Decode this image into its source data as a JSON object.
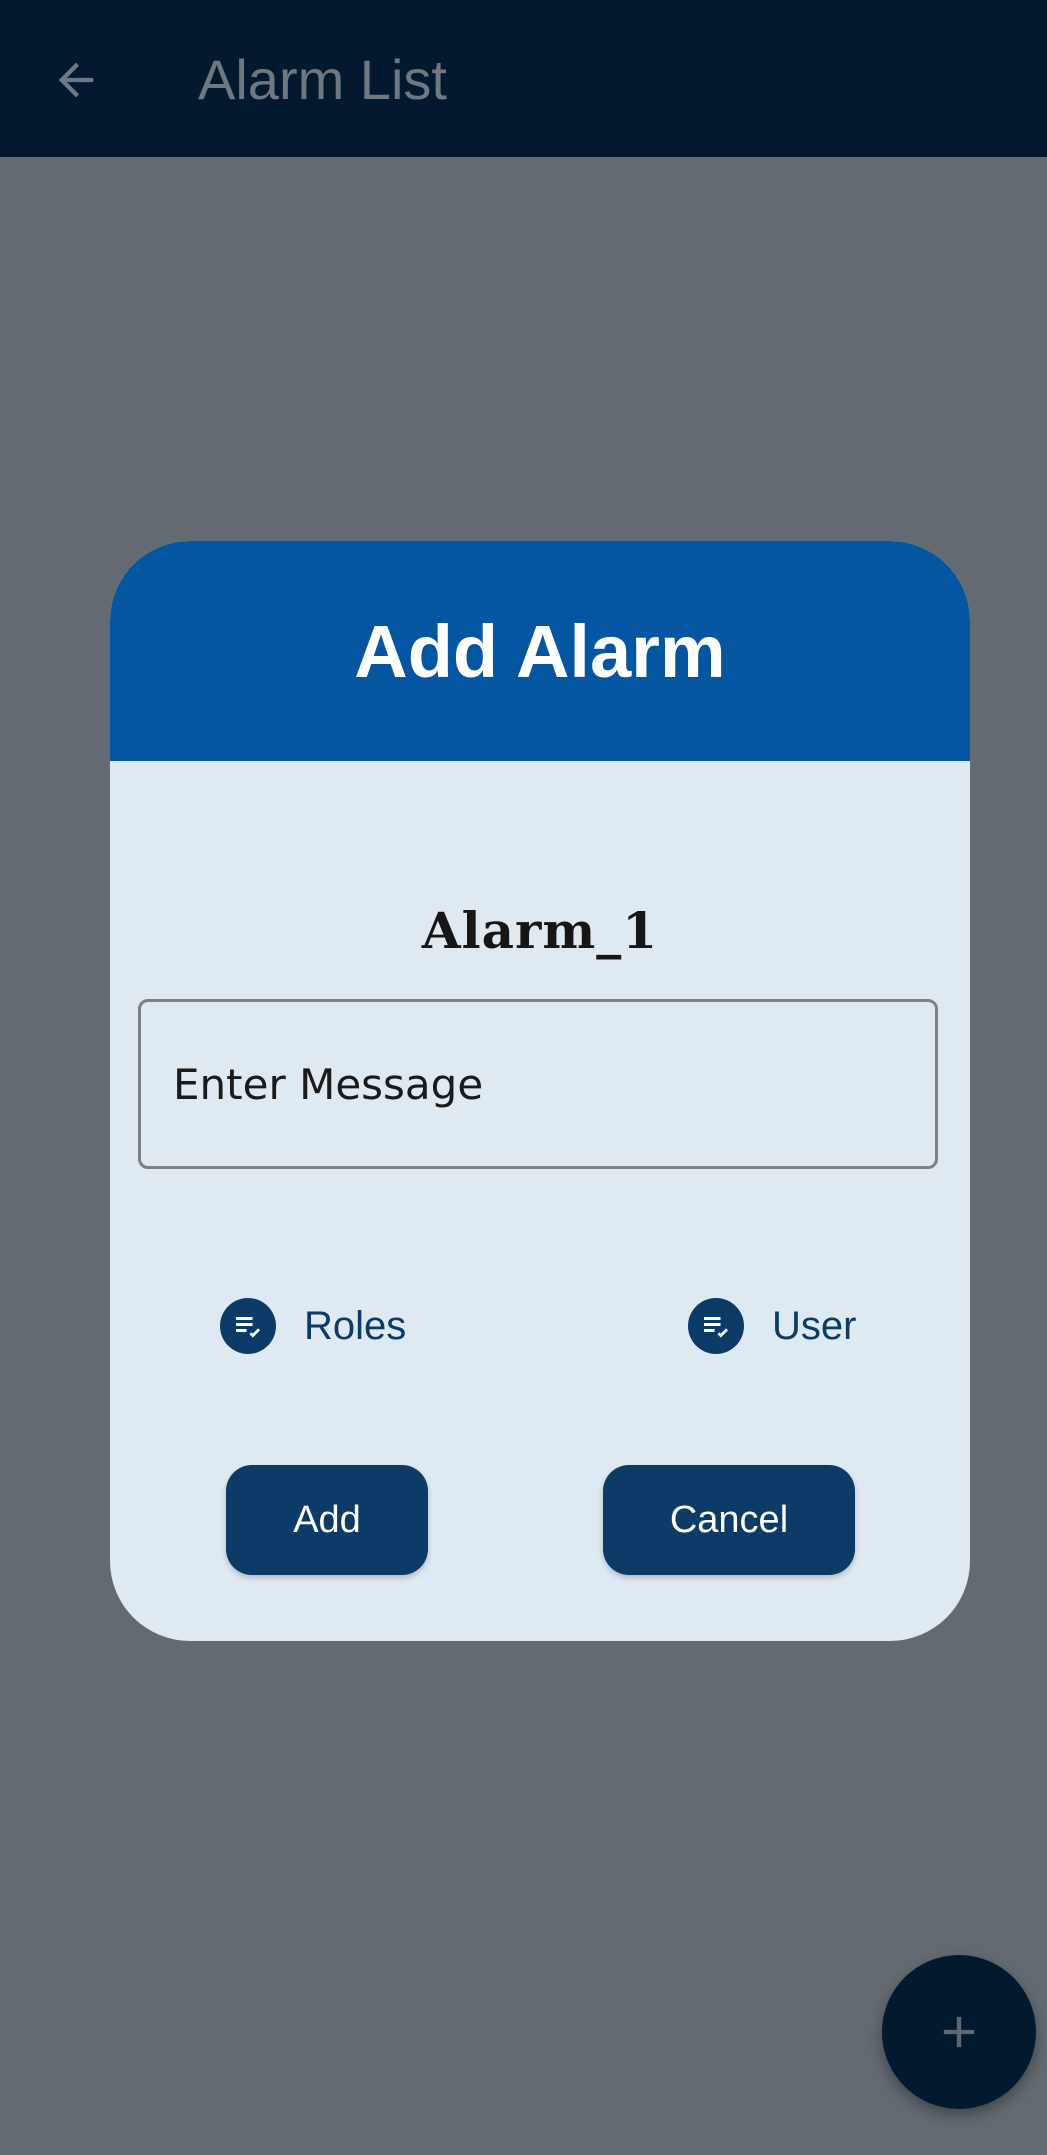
{
  "app_bar": {
    "title": "Alarm List",
    "back_icon": "arrow-left-icon"
  },
  "dialog": {
    "title": "Add Alarm",
    "alarm_name": "Alarm_1",
    "message_input": {
      "placeholder": "Enter Message",
      "value": ""
    },
    "options": [
      {
        "label": "Roles",
        "icon": "checklist-icon"
      },
      {
        "label": "User",
        "icon": "checklist-icon"
      }
    ],
    "add_label": "Add",
    "cancel_label": "Cancel"
  },
  "fab": {
    "icon": "plus-icon"
  },
  "colors": {
    "app_bar": "#021a30",
    "scrim": "#636a71",
    "dialog_header": "#03569f",
    "dialog_body": "#dfe9f1",
    "button": "#0b3b66"
  }
}
